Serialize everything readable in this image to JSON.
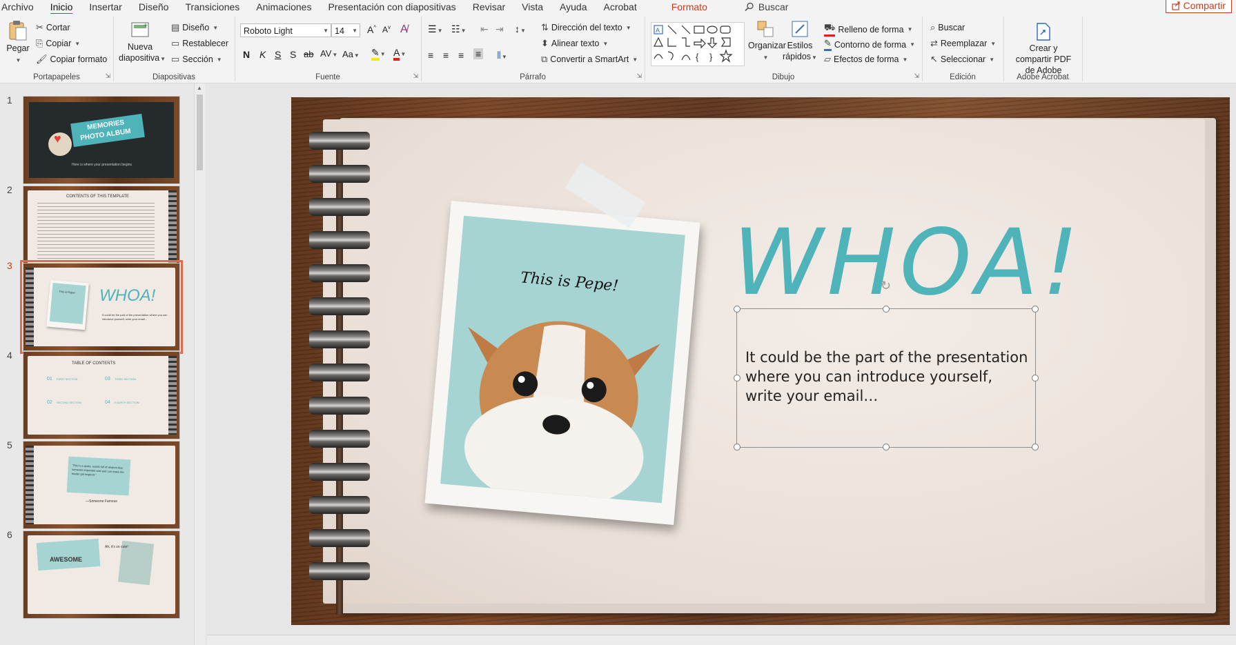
{
  "menu": {
    "tabs": [
      "Archivo",
      "Inicio",
      "Insertar",
      "Diseño",
      "Transiciones",
      "Animaciones",
      "Presentación con diapositivas",
      "Revisar",
      "Vista",
      "Ayuda",
      "Acrobat"
    ],
    "format_tab": "Formato",
    "search_label": "Buscar",
    "share_label": "Compartir"
  },
  "ribbon": {
    "clipboard": {
      "label": "Portapapeles",
      "paste": "Pegar",
      "cut": "Cortar",
      "copy": "Copiar",
      "format_painter": "Copiar formato"
    },
    "slides": {
      "label": "Diapositivas",
      "new_slide": "Nueva diapositiva",
      "layout": "Diseño",
      "reset": "Restablecer",
      "section": "Sección"
    },
    "font": {
      "label": "Fuente",
      "font_name": "Roboto Light",
      "font_size": "14",
      "bold": "N",
      "italic": "K",
      "underline": "S",
      "shadow": "S",
      "strike": "ab",
      "spacing": "AV",
      "case": "Aa"
    },
    "paragraph": {
      "label": "Párrafo",
      "text_direction": "Dirección del texto",
      "align_text": "Alinear texto",
      "smartart": "Convertir a SmartArt"
    },
    "drawing": {
      "label": "Dibujo",
      "arrange": "Organizar",
      "quick_styles": "Estilos rápidos",
      "shape_fill": "Relleno de forma",
      "shape_outline": "Contorno de forma",
      "shape_effects": "Efectos de forma"
    },
    "editing": {
      "label": "Edición",
      "find": "Buscar",
      "replace": "Reemplazar",
      "select": "Seleccionar"
    },
    "acrobat": {
      "label": "Adobe Acrobat",
      "create_share": "Crear y compartir PDF de Adobe"
    }
  },
  "thumbnails": {
    "numbers": [
      "1",
      "2",
      "3",
      "4",
      "5",
      "6"
    ],
    "slide1_title1": "MEMORIES",
    "slide1_title2": "PHOTO ALBUM",
    "slide1_sub": "Here is where your presentation begins",
    "slide2_title": "CONTENTS OF THIS TEMPLATE",
    "slide3_title": "WHOA!",
    "slide3_caption": "This is Pepe!",
    "slide3_text": "It could be the part of the presentation where you can introduce yourself, write your email...",
    "slide4_title": "TABLE OF CONTENTS",
    "slide4_nums": [
      "01",
      "03",
      "02",
      "04"
    ],
    "slide4_sections": [
      "FIRST SECTION",
      "THIRD SECTION",
      "SECOND SECTION",
      "FOURTH SECTION"
    ],
    "slide5_quote": "“This is a quote, words full of wisdom that someone important said and can make the reader get inspired.”",
    "slide5_author": "—Someone Famous",
    "slide6_title": "AWESOME",
    "slide6_sub": "Ah, it’s so cute!"
  },
  "slide": {
    "title": "WHOA!",
    "photo_caption": "This is Pepe!",
    "body": "It could be the part of the presentation where you can introduce yourself, write your email…"
  },
  "colors": {
    "accent": "#c43e1c",
    "teal": "#4fb3ba",
    "photo_bg": "#a6d4d3",
    "wood": "#6b3e21",
    "paper": "#f1e9e3"
  }
}
